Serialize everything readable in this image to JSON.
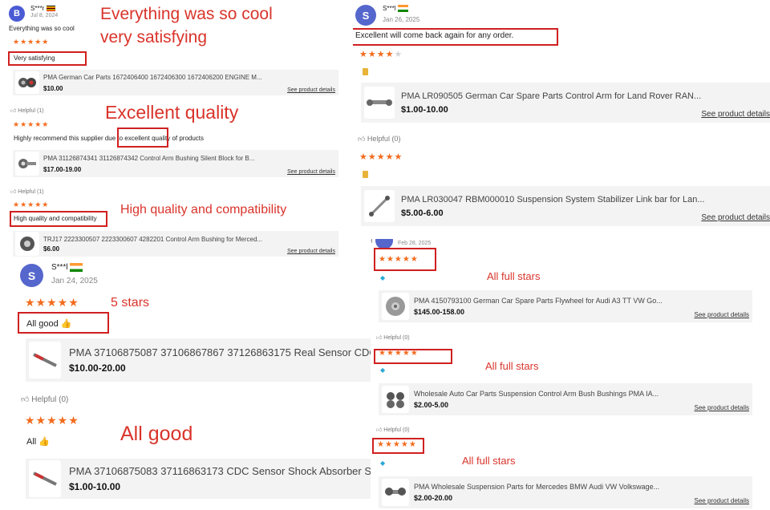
{
  "annotation_color": "#d9342b",
  "star_color": "#f26b1d",
  "panels": {
    "top_left": {
      "reviewer": {
        "initial": "B",
        "name": "S***r",
        "date": "Jul 8, 2024",
        "flag": "uganda-flag-icon"
      },
      "review1": {
        "text": "Everything was so cool",
        "highlight": "Very satisfying",
        "rating": 5,
        "product": {
          "title": "PMA German Car Parts 1672406400 1672406300 1672406200 ENGINE M...",
          "price": "$10.00",
          "link": "See product details"
        }
      },
      "review2": {
        "helpful": "Helpful (1)",
        "rating": 5,
        "text_before": "Highly recommend this supplier due to ",
        "text_highlight": "excellent quality",
        "text_after": " of products",
        "product": {
          "title": "PMA 31126874341 31126874342 Control Arm Bushing Silent Block for B...",
          "price": "$17.00-19.00",
          "link": "See product details"
        }
      },
      "review3": {
        "helpful": "Helpful (1)",
        "rating": 5,
        "highlight": "High quality and compatibility",
        "product": {
          "title": "TRJ17 2223300507 2223300607 4282201 Control Arm Bushing for Merced...",
          "price": "$6.00",
          "link": "See product details"
        }
      },
      "annotations": {
        "a1": "Everything was so cool",
        "a2": "very satisfying",
        "a3": "Excellent quality",
        "a4": "High quality and compatibility"
      }
    },
    "top_right": {
      "reviewer": {
        "initial": "S",
        "name": "S***l",
        "date": "Jan 26, 2025",
        "flag": "india-flag-icon"
      },
      "review1": {
        "highlight": "Excellent will come back again for any order.",
        "rating": 4,
        "badge": "gold-badge-icon",
        "product": {
          "title": "PMA LR090505 German Car Spare Parts Control Arm for Land Rover RAN...",
          "price": "$1.00-10.00",
          "link": "See product details"
        }
      },
      "review2": {
        "helpful": "Helpful (0)",
        "rating": 5,
        "badge": "gold-badge-icon",
        "product": {
          "title": "PMA LR030047 RBM000010 Suspension System Stabilizer Link bar for Lan...",
          "price": "$5.00-6.00",
          "link": "See product details"
        }
      }
    },
    "bottom_left": {
      "reviewer": {
        "initial": "S",
        "name": "S***l",
        "date": "Jan 24, 2025",
        "flag": "india-flag-icon"
      },
      "review1": {
        "rating": 5,
        "highlight": "All good 👍",
        "product": {
          "title": "PMA 37106875087 37106867867 37126863175 Real Sensor CDC Shock",
          "price": "$10.00-20.00"
        }
      },
      "review2": {
        "helpful": "Helpful (0)",
        "rating": 5,
        "text": "All 👍",
        "product": {
          "title": "PMA 37106875083 37116863173 CDC Sensor Shock Absorber Strut",
          "price": "$1.00-10.00"
        }
      },
      "annotations": {
        "a1": "5 stars",
        "a2": "All good"
      }
    },
    "bottom_right": {
      "header": {
        "helpful": "H",
        "date": "Feb 28, 2025"
      },
      "review1": {
        "rating": 5,
        "badge": "diamond-badge-icon",
        "product": {
          "title": "PMA 4150793100 German Car Spare Parts Flywheel for Audi A3 TT VW Go...",
          "price": "$145.00-158.00",
          "link": "See product details"
        }
      },
      "review2": {
        "helpful": "Helpful (0)",
        "rating": 5,
        "badge": "diamond-badge-icon",
        "product": {
          "title": "Wholesale Auto Car Parts Suspension Control Arm Bush Bushings PMA IA...",
          "price": "$2.00-5.00",
          "link": "See product details"
        }
      },
      "review3": {
        "helpful": "Helpful (0)",
        "rating": 5,
        "badge": "diamond-badge-icon",
        "product": {
          "title": "PMA Wholesale Suspension Parts for Mercedes BMW Audi VW Volkswage...",
          "price": "$2.00-20.00",
          "link": "See product details"
        }
      },
      "annotations": {
        "a1": "All full stars",
        "a2": "All full stars",
        "a3": "All full stars"
      }
    }
  }
}
